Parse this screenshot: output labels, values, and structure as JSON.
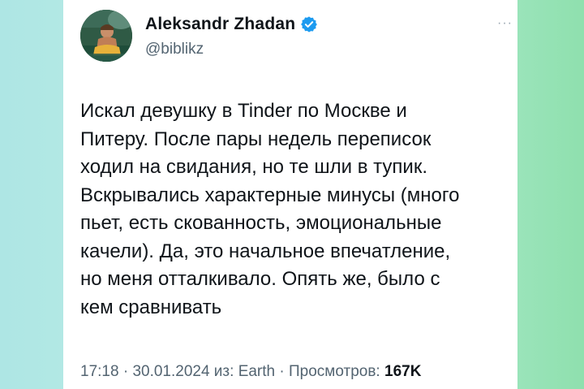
{
  "author": {
    "name": "Aleksandr Zhadan",
    "handle": "@biblikz",
    "verified_icon": "verified-badge-icon",
    "avatar_icon": "avatar-photo"
  },
  "more_icon": "more-dots-icon",
  "tweet": {
    "lines": [
      "Искал девушку в Tinder по Москве и",
      "Питеру. После пары недель переписок",
      "ходил на свидания, но те шли в тупик.",
      "Вскрывались характерные минусы (много",
      "пьет, есть скованность, эмоциональные",
      "качели). Да, это начальное впечатление,",
      "но меня отталкивало. Опять же, было с",
      "кем сравнивать"
    ]
  },
  "meta": {
    "time": "17:18",
    "sep1": " · ",
    "date": "30.01.2024",
    "source": " из: Earth",
    "sep2": " · ",
    "views_label": "Просмотров: ",
    "views_count": "167K"
  },
  "colors": {
    "accent_verified": "#1d9bf0",
    "text_primary": "#0f1419",
    "text_secondary": "#536471"
  }
}
